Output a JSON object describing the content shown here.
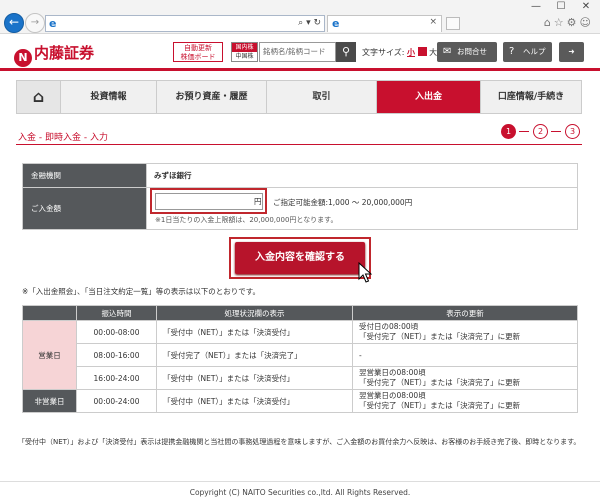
{
  "browser": {
    "address_tools": "⌕ ▾ ↻",
    "tab_close": "×",
    "win_minimize": "—",
    "win_maximize": "☐",
    "win_close": "✕",
    "right_icons": "⌂☆⚙☺"
  },
  "header": {
    "logo_text": "内藤証券",
    "auto_update_line1": "自動更新",
    "auto_update_line2": "株価ボード",
    "market_top": "国内株",
    "market_bottom": "中国株",
    "search_placeholder": "銘柄名/銘柄コード",
    "font_size_label": "文字サイズ:",
    "font_small": "小",
    "font_large": "大",
    "contact_label": "お問合せ",
    "help_label": "ヘルプ"
  },
  "nav": {
    "items": [
      "投資情報",
      "お預り資産・履歴",
      "取引",
      "入出金",
      "口座情報/手続き"
    ],
    "active": "入出金"
  },
  "page": {
    "title": "入金 - 即時入金 - 入力",
    "steps": [
      "1",
      "2",
      "3"
    ],
    "current_step": "1"
  },
  "form": {
    "bank_label": "金融機関",
    "bank_value": "みずほ銀行",
    "amount_label": "ご入金額",
    "amount_value": "",
    "yen": "円",
    "available": "ご指定可能金額:1,000 ～ 20,000,000円",
    "limit_note": "※1日当たりの入金上限額は、20,000,000円となります。"
  },
  "confirm_button": "入金内容を確認する",
  "note1": "※「入出金照会」、「当日注文約定一覧」等の表示は以下のとおりです。",
  "schedule": {
    "headers": [
      "振込時間",
      "処理状況欄の表示",
      "表示の更新"
    ],
    "weekday_label": "営業日",
    "holiday_label": "非営業日",
    "rows": [
      {
        "time": "00:00-08:00",
        "status": "「受付中（NET）」または「決済受付」",
        "update1": "受付日の08:00頃",
        "update2": "「受付完了（NET）」または「決済完了」に更新"
      },
      {
        "time": "08:00-16:00",
        "status": "「受付完了（NET）」または「決済完了」",
        "update1": "-",
        "update2": ""
      },
      {
        "time": "16:00-24:00",
        "status": "「受付中（NET）」または「決済受付」",
        "update1": "翌営業日の08:00頃",
        "update2": "「受付完了（NET）」または「決済完了」に更新"
      },
      {
        "time": "00:00-24:00",
        "status": "「受付中（NET）」または「決済受付」",
        "update1": "翌営業日の08:00頃",
        "update2": "「受付完了（NET）」または「決済完了」に更新"
      }
    ]
  },
  "note2": "「受付中（NET）」および「決済受付」表示は提携金融機関と当社間の事務処理過程を意味しますが、ご入金額のお買付余力へ反映は、お客様のお手続き完了後、即時となります。",
  "copyright": "Copyright (C) NAITO Securities co.,ltd. All Rights Reserved.",
  "colors": {
    "brand": "#c8102e",
    "label_bg": "#55585b",
    "weekday_bg": "#f6d4d6"
  }
}
